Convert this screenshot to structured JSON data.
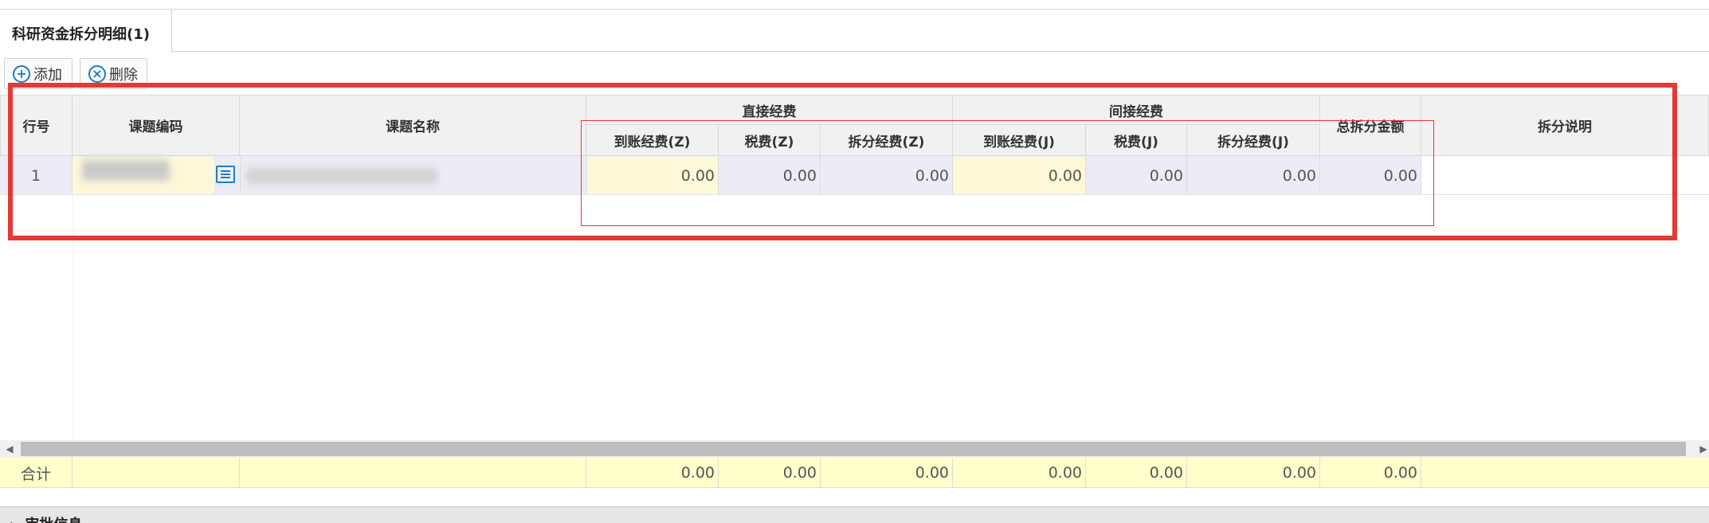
{
  "tabs": [
    {
      "label": "科研资金拆分明细(1)"
    }
  ],
  "toolbar": {
    "add_label": "添加",
    "delete_label": "删除"
  },
  "grid": {
    "headers": {
      "row_no": "行号",
      "project_code": "课题编码",
      "project_name": "课题名称",
      "direct_group": "直接经费",
      "indirect_group": "间接经费",
      "arrived_z": "到账经费(Z)",
      "tax_z": "税费(Z)",
      "split_z": "拆分经费(Z)",
      "arrived_j": "到账经费(J)",
      "tax_j": "税费(J)",
      "split_j": "拆分经费(J)",
      "total_split": "总拆分金额",
      "split_note": "拆分说明"
    },
    "rows": [
      {
        "row_no": "1",
        "arrived_z": "0.00",
        "tax_z": "0.00",
        "split_z": "0.00",
        "arrived_j": "0.00",
        "tax_j": "0.00",
        "split_j": "0.00",
        "total_split": "0.00"
      }
    ],
    "totals": {
      "label": "合计",
      "arrived_z": "0.00",
      "tax_z": "0.00",
      "split_z": "0.00",
      "arrived_j": "0.00",
      "tax_j": "0.00",
      "split_j": "0.00",
      "total_split": "0.00"
    }
  },
  "footer": {
    "section_label": "审批信息"
  },
  "icons": {
    "add": "plus-circle-icon",
    "delete": "x-circle-icon",
    "lookup": "list-icon",
    "expand": "chevron-right-icon"
  },
  "colors": {
    "accent": "#1e7bc6",
    "highlight_red": "#e53935",
    "editable_yellow": "#fff8d8",
    "total_row": "#ffffcc"
  }
}
